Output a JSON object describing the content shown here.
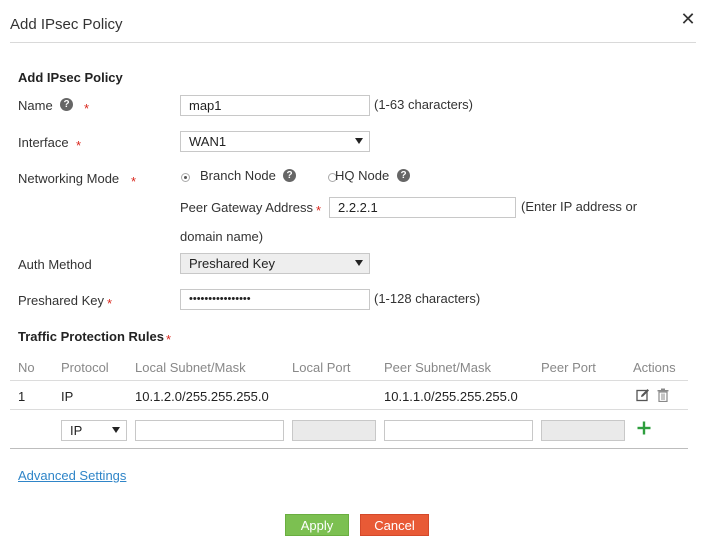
{
  "dialog": {
    "title": "Add IPsec Policy",
    "close_icon": "close-icon",
    "close_glyph": "✕"
  },
  "form": {
    "section_title": "Add IPsec Policy",
    "name": {
      "label": "Name",
      "value": "map1",
      "hint": "(1-63 characters)"
    },
    "interface": {
      "label": "Interface",
      "value": "WAN1"
    },
    "networking_mode": {
      "label": "Networking Mode",
      "options": [
        {
          "label": "Branch Node",
          "selected": true
        },
        {
          "label": "HQ Node",
          "selected": false
        }
      ],
      "peer_gateway_label": "Peer Gateway Address",
      "peer_gateway_value": "2.2.2.1",
      "peer_gateway_hint_line1": "(Enter IP address or",
      "peer_gateway_hint_line2": "domain name)"
    },
    "auth_method": {
      "label": "Auth Method",
      "value": "Preshared Key"
    },
    "preshared_key": {
      "label": "Preshared Key",
      "value": "••••••••••••••••",
      "hint": "(1-128 characters)"
    },
    "required_mark": "*",
    "help_glyph": "?"
  },
  "rules": {
    "section_title": "Traffic Protection Rules",
    "columns": [
      "No",
      "Protocol",
      "Local Subnet/Mask",
      "Local Port",
      "Peer Subnet/Mask",
      "Peer Port",
      "Actions"
    ],
    "rows": [
      {
        "no": "1",
        "protocol": "IP",
        "local_subnet": "10.1.2.0/255.255.255.0",
        "local_port": "",
        "peer_subnet": "10.1.1.0/255.255.255.0",
        "peer_port": ""
      }
    ],
    "new_row": {
      "protocol": "IP",
      "local_subnet": "",
      "local_port": "",
      "peer_subnet": "",
      "peer_port": ""
    },
    "add_glyph": "+"
  },
  "advanced_link": "Advanced Settings",
  "buttons": {
    "apply": "Apply",
    "cancel": "Cancel"
  },
  "colors": {
    "apply": "#7cc051",
    "cancel": "#e85a36",
    "required": "#d9261c",
    "link": "#2f85c8",
    "add": "#2e9e3e"
  }
}
